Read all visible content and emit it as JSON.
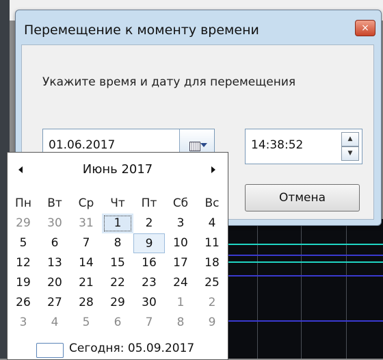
{
  "dialog": {
    "title": "Перемещение к моменту времени",
    "close_symbol": "×",
    "prompt": "Укажите время и дату для перемещения",
    "date_value": "01.06.2017",
    "time_value": "14:38:52",
    "spin_up": "▲",
    "spin_down": "▼",
    "cancel_label": "Отмена"
  },
  "calendar": {
    "month_label": "Июнь 2017",
    "weekdays": [
      "Пн",
      "Вт",
      "Ср",
      "Чт",
      "Пт",
      "Сб",
      "Вс"
    ],
    "weeks": [
      [
        {
          "d": "29",
          "o": true
        },
        {
          "d": "30",
          "o": true
        },
        {
          "d": "31",
          "o": true
        },
        {
          "d": "1",
          "s": "today"
        },
        {
          "d": "2"
        },
        {
          "d": "3"
        },
        {
          "d": "4"
        }
      ],
      [
        {
          "d": "5"
        },
        {
          "d": "6"
        },
        {
          "d": "7"
        },
        {
          "d": "8"
        },
        {
          "d": "9",
          "s": "hover"
        },
        {
          "d": "10"
        },
        {
          "d": "11"
        }
      ],
      [
        {
          "d": "12"
        },
        {
          "d": "13"
        },
        {
          "d": "14"
        },
        {
          "d": "15"
        },
        {
          "d": "16"
        },
        {
          "d": "17"
        },
        {
          "d": "18"
        }
      ],
      [
        {
          "d": "19"
        },
        {
          "d": "20"
        },
        {
          "d": "21"
        },
        {
          "d": "22"
        },
        {
          "d": "23"
        },
        {
          "d": "24"
        },
        {
          "d": "25"
        }
      ],
      [
        {
          "d": "26"
        },
        {
          "d": "27"
        },
        {
          "d": "28"
        },
        {
          "d": "29"
        },
        {
          "d": "30"
        },
        {
          "d": "1",
          "o": true
        },
        {
          "d": "2",
          "o": true
        }
      ],
      [
        {
          "d": "3",
          "o": true
        },
        {
          "d": "4",
          "o": true
        },
        {
          "d": "5",
          "o": true
        },
        {
          "d": "6",
          "o": true
        },
        {
          "d": "7",
          "o": true
        },
        {
          "d": "8",
          "o": true
        },
        {
          "d": "9",
          "o": true
        }
      ]
    ],
    "today_label": "Сегодня: 05.09.2017"
  },
  "colors": {
    "frame": "#c8ddef",
    "accent": "#5a84b8",
    "timeline_cyan": "#20d6c4",
    "timeline_blue": "#3a3ad0"
  }
}
